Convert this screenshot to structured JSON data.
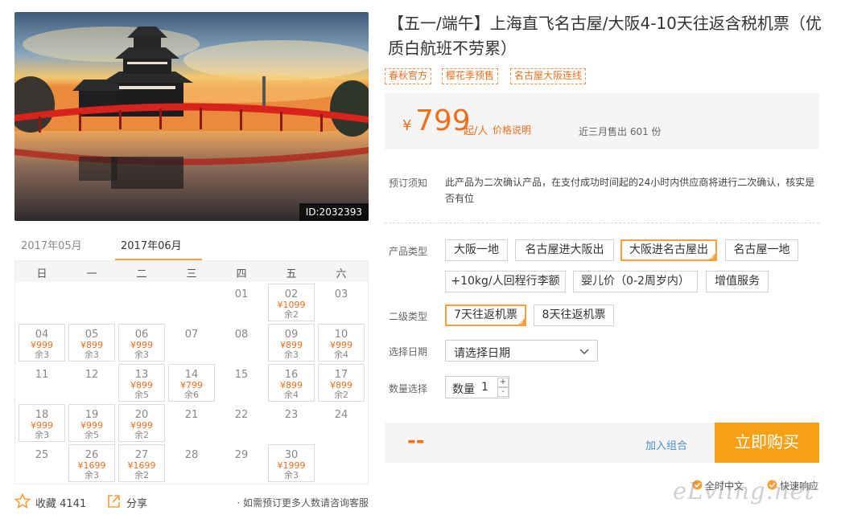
{
  "gallery": {
    "photo_id": "ID:2032393"
  },
  "calendar": {
    "months": [
      "2017年05月",
      "2017年06月"
    ],
    "active_month": 1,
    "weekdays": [
      "日",
      "一",
      "二",
      "三",
      "四",
      "五",
      "六"
    ],
    "days": [
      {
        "day": "01",
        "col": 4,
        "row": 0
      },
      {
        "day": "02",
        "col": 5,
        "row": 0,
        "price": "¥1099",
        "remain": "余2"
      },
      {
        "day": "03",
        "col": 6,
        "row": 0
      },
      {
        "day": "04",
        "col": 0,
        "row": 1,
        "price": "¥999",
        "remain": "余3"
      },
      {
        "day": "05",
        "col": 1,
        "row": 1,
        "price": "¥899",
        "remain": "余3"
      },
      {
        "day": "06",
        "col": 2,
        "row": 1,
        "price": "¥999",
        "remain": "余3"
      },
      {
        "day": "07",
        "col": 3,
        "row": 1
      },
      {
        "day": "08",
        "col": 4,
        "row": 1
      },
      {
        "day": "09",
        "col": 5,
        "row": 1,
        "price": "¥899",
        "remain": "余3"
      },
      {
        "day": "10",
        "col": 6,
        "row": 1,
        "price": "¥999",
        "remain": "余4"
      },
      {
        "day": "11",
        "col": 0,
        "row": 2
      },
      {
        "day": "12",
        "col": 1,
        "row": 2
      },
      {
        "day": "13",
        "col": 2,
        "row": 2,
        "price": "¥899",
        "remain": "余5"
      },
      {
        "day": "14",
        "col": 3,
        "row": 2,
        "price": "¥799",
        "remain": "余6"
      },
      {
        "day": "15",
        "col": 4,
        "row": 2
      },
      {
        "day": "16",
        "col": 5,
        "row": 2,
        "price": "¥899",
        "remain": "余4"
      },
      {
        "day": "17",
        "col": 6,
        "row": 2,
        "price": "¥899",
        "remain": "余2"
      },
      {
        "day": "18",
        "col": 0,
        "row": 3,
        "price": "¥999",
        "remain": "余3"
      },
      {
        "day": "19",
        "col": 1,
        "row": 3,
        "price": "¥999",
        "remain": "余5"
      },
      {
        "day": "20",
        "col": 2,
        "row": 3,
        "price": "¥999",
        "remain": "余2"
      },
      {
        "day": "21",
        "col": 3,
        "row": 3
      },
      {
        "day": "22",
        "col": 4,
        "row": 3
      },
      {
        "day": "23",
        "col": 5,
        "row": 3
      },
      {
        "day": "24",
        "col": 6,
        "row": 3
      },
      {
        "day": "25",
        "col": 0,
        "row": 4
      },
      {
        "day": "26",
        "col": 1,
        "row": 4,
        "price": "¥1699",
        "remain": "余3"
      },
      {
        "day": "27",
        "col": 2,
        "row": 4,
        "price": "¥1699",
        "remain": "余2"
      },
      {
        "day": "28",
        "col": 3,
        "row": 4
      },
      {
        "day": "29",
        "col": 4,
        "row": 4
      },
      {
        "day": "30",
        "col": 5,
        "row": 4,
        "price": "¥1999",
        "remain": "余3"
      }
    ]
  },
  "actions": {
    "favorite": "收藏 4141",
    "share": "分享",
    "note": "· 如需预订更多人数请咨询客服"
  },
  "product": {
    "title": "【五一/端午】上海直飞名古屋/大阪4-10天往返含税机票（优质白航班不劳累）",
    "tags": [
      "春秋官方",
      "樱花季预售",
      "名古屋大阪连线"
    ],
    "currency": "¥",
    "price": "799",
    "price_unit": "起/人",
    "price_explain": "价格说明",
    "sold": "近三月售出 601 份"
  },
  "booking": {
    "notice_label": "预订须知",
    "notice_text": "此产品为二次确认产品，在支付成功时间起的24小时内供应商将进行二次确认，核实是否有位",
    "type_label": "产品类型",
    "types": [
      "大阪一地",
      "名古屋进大阪出",
      "大阪进名古屋出",
      "名古屋一地",
      "+10kg/人回程行李额",
      "婴儿价（0-2周岁内）",
      "增值服务"
    ],
    "selected_type": 2,
    "sub_label": "二级类型",
    "sub_types": [
      "7天往返机票",
      "8天往返机票"
    ],
    "selected_sub": 0,
    "date_label": "选择日期",
    "date_placeholder": "请选择日期",
    "qty_label": "数量选择",
    "qty_text": "数量",
    "qty_value": "1",
    "qty_plus": "+",
    "qty_minus": "-",
    "total": "--",
    "add_combo": "加入组合",
    "buy": "立即购买",
    "services": [
      "全时中文",
      "快速响应"
    ]
  },
  "watermark": "eLvling.net",
  "colors": {
    "accent": "#ee6f1c",
    "button": "#f7a014",
    "selected_border": "#f7a03b",
    "link": "#4a90c6"
  }
}
